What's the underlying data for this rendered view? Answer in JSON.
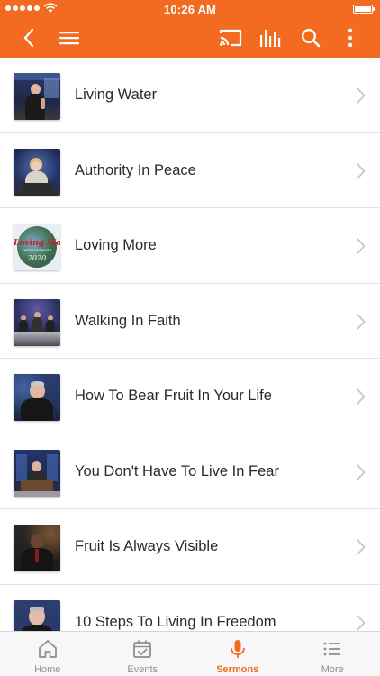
{
  "status_bar": {
    "time": "10:26 AM"
  },
  "header": {
    "icons": [
      "back-icon",
      "menu-icon",
      "cast-icon",
      "audio-bars-icon",
      "search-icon",
      "more-vertical-icon"
    ]
  },
  "colors": {
    "accent": "#f26b21",
    "tab_inactive": "#8e8e93",
    "divider": "#e4e4e4"
  },
  "sermons": [
    {
      "title": "Living Water"
    },
    {
      "title": "Authority In Peace"
    },
    {
      "title": "Loving More",
      "thumb_text": "Loving More",
      "thumb_subtext": "THROUGH PRAYER",
      "thumb_year": "2020"
    },
    {
      "title": "Walking In Faith"
    },
    {
      "title": "How To Bear Fruit In Your Life"
    },
    {
      "title": "You Don't Have To Live In Fear"
    },
    {
      "title": "Fruit Is Always Visible"
    },
    {
      "title": "10 Steps To Living In Freedom"
    }
  ],
  "tabs": [
    {
      "label": "Home",
      "icon": "home-icon",
      "active": false
    },
    {
      "label": "Events",
      "icon": "calendar-check-icon",
      "active": false
    },
    {
      "label": "Sermons",
      "icon": "microphone-icon",
      "active": true
    },
    {
      "label": "More",
      "icon": "list-icon",
      "active": false
    }
  ]
}
